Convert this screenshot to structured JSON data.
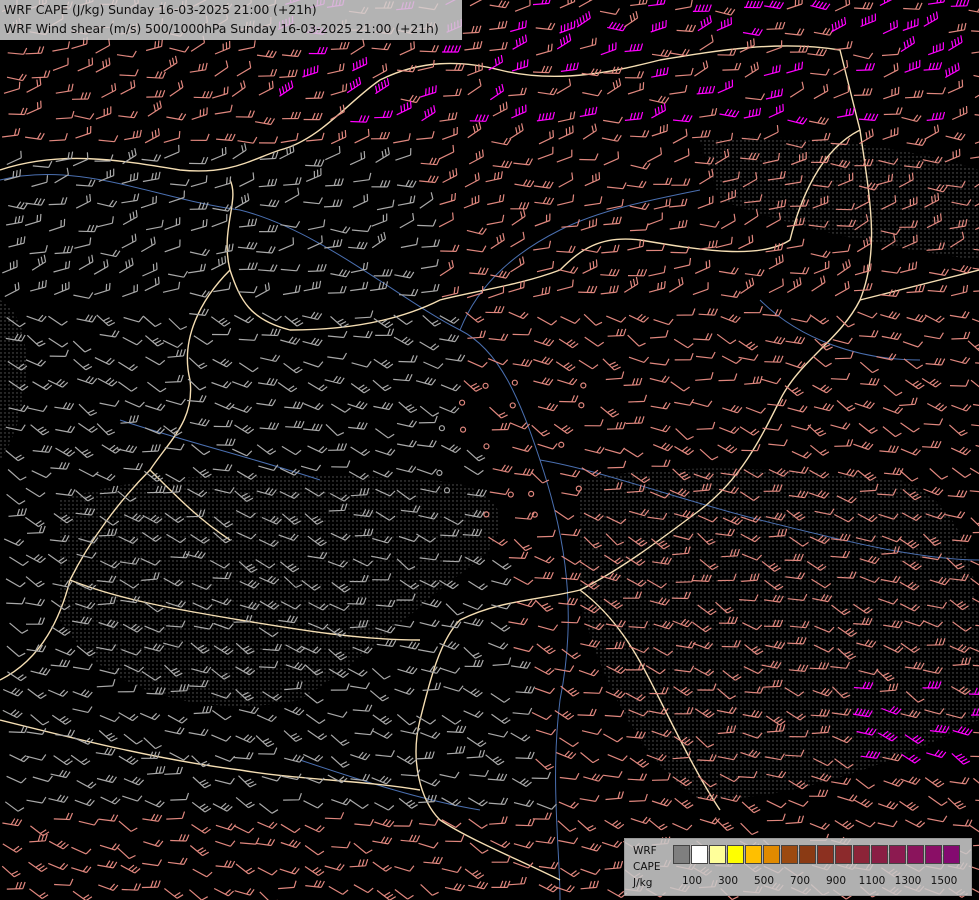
{
  "header": {
    "line1": "WRF CAPE (J/kg) Sunday 16-03-2025 21:00 (+21h)",
    "line2": "WRF Wind shear (m/s) 500/1000hPa Sunday 16-03-2025 21:00 (+21h)"
  },
  "legend": {
    "title_line1": "WRF",
    "title_line2": "CAPE",
    "units": "J/kg",
    "swatches": [
      "#7f7f7f",
      "#ffffff",
      "#ffff9a",
      "#ffff00",
      "#ffbf00",
      "#e08a00",
      "#9c4a10",
      "#8a3a14",
      "#8c3020",
      "#8c2a2c",
      "#8c2438",
      "#8a1e44",
      "#8c1a50",
      "#8a145c",
      "#8a0e66",
      "#840a70"
    ],
    "ticks": [
      "100",
      "300",
      "500",
      "700",
      "900",
      "1100",
      "1300",
      "1500"
    ]
  },
  "colors": {
    "background": "#000000",
    "barb_low": "#a9a9a9",
    "barb_mid": "#e0877e",
    "barb_high": "#ff00ff",
    "barb_yellow": "#ffff00",
    "borders": "#f5deb3",
    "rivers": "#4a6fb0"
  }
}
